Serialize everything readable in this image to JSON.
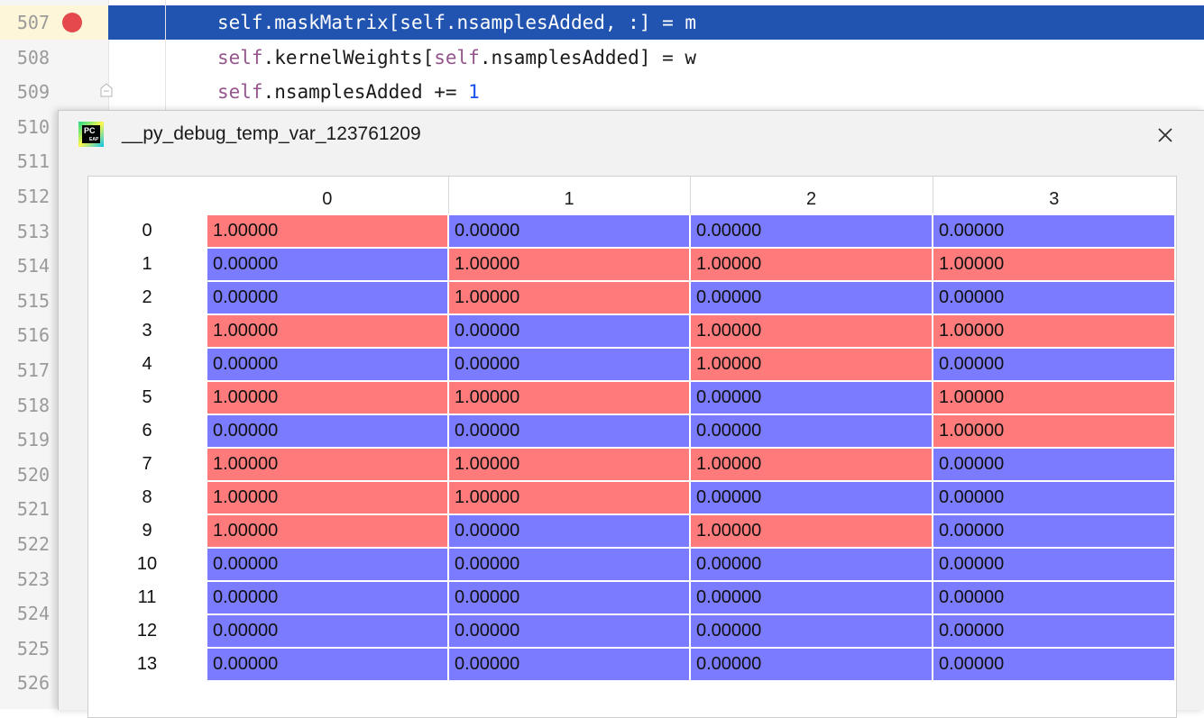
{
  "editor": {
    "line_numbers": [
      "507",
      "508",
      "509",
      "510",
      "511",
      "512",
      "513",
      "514",
      "515",
      "516",
      "517",
      "518",
      "519",
      "520",
      "521",
      "522",
      "523",
      "524",
      "525",
      "526"
    ],
    "code_lines": [
      {
        "line": "507",
        "parts": [
          {
            "t": "self",
            "c": "plain"
          },
          {
            "t": ".maskMatrix[",
            "c": "plain"
          },
          {
            "t": "self",
            "c": "plain"
          },
          {
            "t": ".nsamplesAdded, :] = m",
            "c": "plain"
          }
        ]
      },
      {
        "line": "508",
        "parts": [
          {
            "t": "self",
            "c": "kw"
          },
          {
            "t": ".kernelWeights[",
            "c": "plain"
          },
          {
            "t": "self",
            "c": "kw"
          },
          {
            "t": ".nsamplesAdded] = w",
            "c": "plain"
          }
        ]
      },
      {
        "line": "509",
        "parts": [
          {
            "t": "self",
            "c": "kw"
          },
          {
            "t": ".nsamplesAdded += ",
            "c": "plain"
          },
          {
            "t": "1",
            "c": "num"
          }
        ]
      }
    ],
    "highlighted_line": "507",
    "colors": {
      "highlight": "#2154b0",
      "keyword": "#94558d",
      "number": "#1750eb",
      "breakpoint": "#e5484d"
    }
  },
  "dialog": {
    "title": "__py_debug_temp_var_123761209",
    "icon_text_top": "PC",
    "icon_text_bottom": "EAP",
    "close_label": "✕"
  },
  "table": {
    "columns": [
      "0",
      "1",
      "2",
      "3"
    ],
    "rows": [
      {
        "index": "0",
        "values": [
          "1.00000",
          "0.00000",
          "0.00000",
          "0.00000"
        ]
      },
      {
        "index": "1",
        "values": [
          "0.00000",
          "1.00000",
          "1.00000",
          "1.00000"
        ]
      },
      {
        "index": "2",
        "values": [
          "0.00000",
          "1.00000",
          "0.00000",
          "0.00000"
        ]
      },
      {
        "index": "3",
        "values": [
          "1.00000",
          "0.00000",
          "1.00000",
          "1.00000"
        ]
      },
      {
        "index": "4",
        "values": [
          "0.00000",
          "0.00000",
          "1.00000",
          "0.00000"
        ]
      },
      {
        "index": "5",
        "values": [
          "1.00000",
          "1.00000",
          "0.00000",
          "1.00000"
        ]
      },
      {
        "index": "6",
        "values": [
          "0.00000",
          "0.00000",
          "0.00000",
          "1.00000"
        ]
      },
      {
        "index": "7",
        "values": [
          "1.00000",
          "1.00000",
          "1.00000",
          "0.00000"
        ]
      },
      {
        "index": "8",
        "values": [
          "1.00000",
          "1.00000",
          "0.00000",
          "0.00000"
        ]
      },
      {
        "index": "9",
        "values": [
          "1.00000",
          "0.00000",
          "1.00000",
          "0.00000"
        ]
      },
      {
        "index": "10",
        "values": [
          "0.00000",
          "0.00000",
          "0.00000",
          "0.00000"
        ]
      },
      {
        "index": "11",
        "values": [
          "0.00000",
          "0.00000",
          "0.00000",
          "0.00000"
        ]
      },
      {
        "index": "12",
        "values": [
          "0.00000",
          "0.00000",
          "0.00000",
          "0.00000"
        ]
      },
      {
        "index": "13",
        "values": [
          "0.00000",
          "0.00000",
          "0.00000",
          "0.00000"
        ]
      }
    ],
    "colors": {
      "high": "#ff7b7b",
      "low": "#7b7bff"
    }
  }
}
